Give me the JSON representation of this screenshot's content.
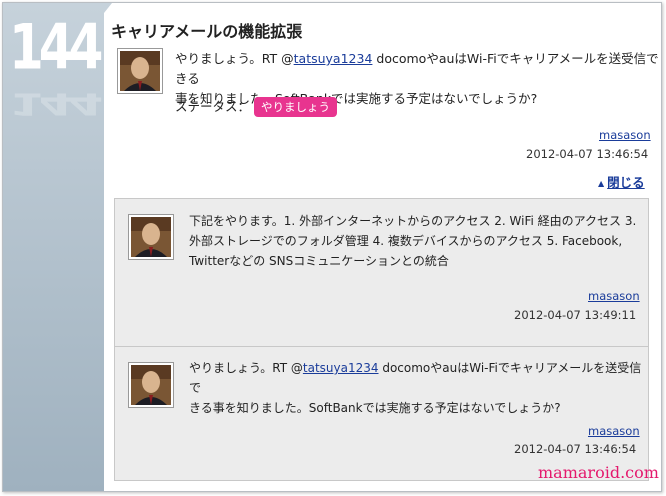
{
  "entry": {
    "number": "144",
    "title": "キャリアメールの機能拡張",
    "post": {
      "text_before_mention": "やりましょう。RT @",
      "mention": "tatsuya1234",
      "text_line1_rest": " docomoやauはWi-Fiでキャリアメールを送受信できる",
      "text_line2": "事を知りました。SoftBankでは実施する予定はないでしょうか?",
      "author": "masason",
      "date": "2012-04-07 13:46:54"
    },
    "status_label": "ステータス：",
    "status_badge": "やりましょう",
    "close_label": "閉じる"
  },
  "thread": [
    {
      "line1": "下記をやります。1. 外部インターネットからのアクセス 2. WiFi 経由のアクセス 3.",
      "line2": "外部ストレージでのフォルダ管理 4. 複数デバイスからのアクセス 5. Facebook,",
      "line3": "Twitterなどの SNSコミュニケーションとの統合",
      "author": "masason",
      "date": "2012-04-07 13:49:11"
    },
    {
      "text_before_mention": "やりましょう。RT @",
      "mention": "tatsuya1234",
      "line1_rest": " docomoやauはWi-Fiでキャリアメールを送受信で",
      "line2": "きる事を知りました。SoftBankでは実施する予定はないでしょうか?",
      "author": "masason",
      "date": "2012-04-07 13:46:54"
    }
  ],
  "watermark": "mamaroid.com",
  "colors": {
    "accent_pink": "#e8348f",
    "link_blue": "#1a3c9a",
    "rail": "#9fb1bf"
  }
}
